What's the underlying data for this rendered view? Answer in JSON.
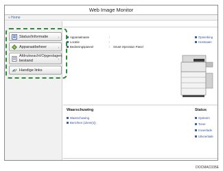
{
  "window": {
    "title": "Web Image Monitor"
  },
  "nav": {
    "home": "Home"
  },
  "sidebar": {
    "items": [
      {
        "label": "Status/Informatie",
        "chevron": "›",
        "icon": "status-icon"
      },
      {
        "label": "Apparaatbeheer",
        "chevron": "›",
        "icon": "device-management-icon"
      },
      {
        "label_line1": "Afdrukwacht/Opgeslagen",
        "label_line2": "bestand",
        "chevron": "›",
        "icon": "print-queue-icon"
      },
      {
        "label": "Handige links",
        "icon": "links-icon"
      }
    ]
  },
  "device_info": {
    "rows": [
      {
        "label": "Apparaatnaam",
        "colon": ":",
        "value": ""
      },
      {
        "label": "Locatie",
        "colon": ":",
        "value": ""
      },
      {
        "label": "Bedieningspaneel",
        "colon": ":",
        "value": "Smart Operation Panel"
      }
    ],
    "right_links": [
      "Opmerking",
      "Hostnaam"
    ]
  },
  "warning": {
    "title": "Waarschuwing",
    "links": [
      "Waarschuwing",
      "Berichten (1item(s))"
    ]
  },
  "status": {
    "title": "Status",
    "links": [
      "Systeem",
      "Toner",
      "Invoerlade",
      "Uitvoerlade"
    ]
  },
  "doc_code": "DOCMAC035E",
  "colors": {
    "link": "#3d5fa8",
    "highlight": "#2f8a3a"
  }
}
